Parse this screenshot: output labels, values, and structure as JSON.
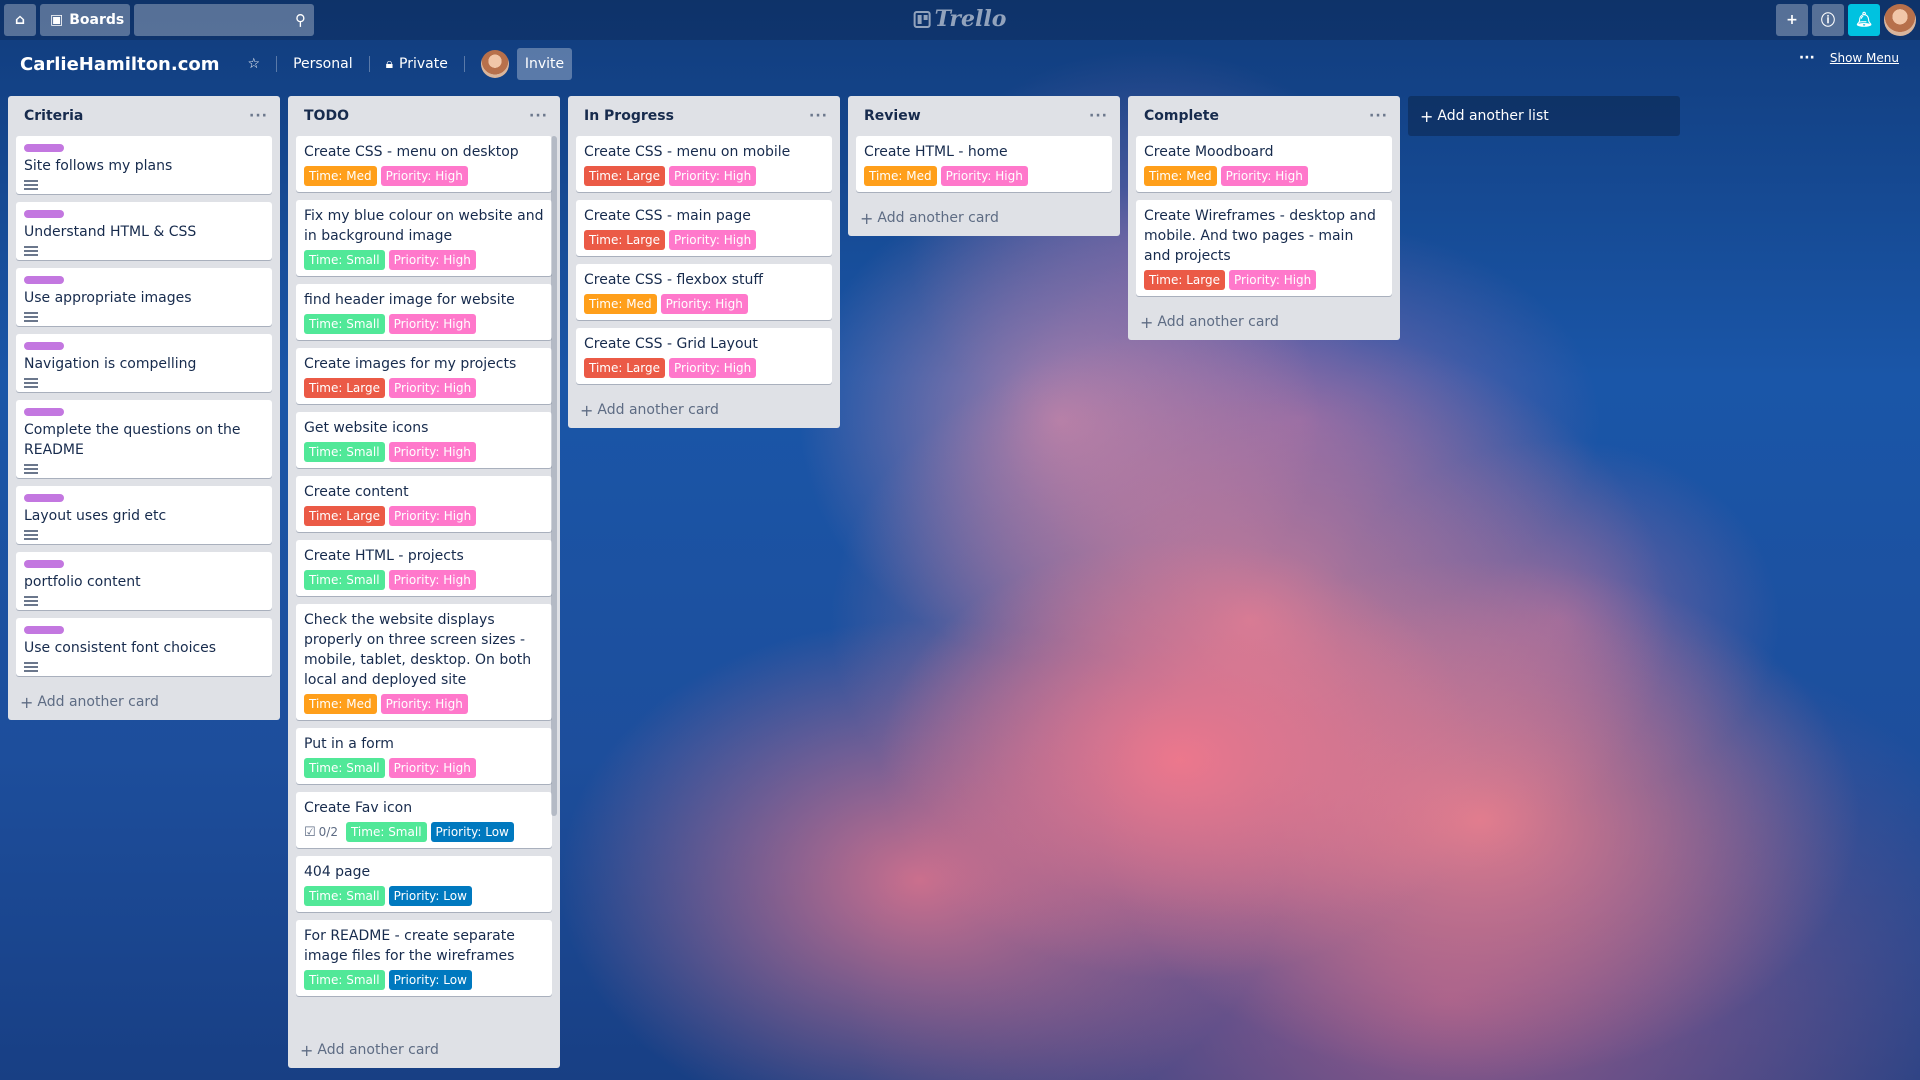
{
  "header": {
    "boards_label": "Boards",
    "search_value": "",
    "logo_text": "Trello"
  },
  "board": {
    "title": "CarlieHamilton.com",
    "team": "Personal",
    "visibility": "Private",
    "invite_label": "Invite",
    "show_menu_label": "Show Menu"
  },
  "colors": {
    "time_small": "#61bd4f",
    "time_small_text": "#51e898",
    "time_med": "#ff9f1a",
    "time_large": "#eb5a46",
    "priority_high": "#ff78cb",
    "priority_low": "#0079bf",
    "criteria_label": "#c377e0"
  },
  "lists": [
    {
      "title": "Criteria",
      "add_card": "Add another card",
      "cards": [
        {
          "title": "Site follows my plans"
        },
        {
          "title": "Understand HTML & CSS"
        },
        {
          "title": "Use appropriate images"
        },
        {
          "title": "Navigation is compelling"
        },
        {
          "title": "Complete the questions on the README"
        },
        {
          "title": "Layout uses grid etc"
        },
        {
          "title": "portfolio content"
        },
        {
          "title": "Use consistent font choices"
        }
      ]
    },
    {
      "title": "TODO",
      "add_card": "Add another card",
      "cards": [
        {
          "title": "Create CSS - menu on desktop",
          "time": "Time: Med",
          "priority": "Priority: High"
        },
        {
          "title": "Fix my blue colour on website and in background image",
          "time": "Time: Small",
          "priority": "Priority: High"
        },
        {
          "title": "find header image for website",
          "time": "Time: Small",
          "priority": "Priority: High"
        },
        {
          "title": "Create images for my projects",
          "time": "Time: Large",
          "priority": "Priority: High"
        },
        {
          "title": "Get website icons",
          "time": "Time: Small",
          "priority": "Priority: High"
        },
        {
          "title": "Create content",
          "time": "Time: Large",
          "priority": "Priority: High"
        },
        {
          "title": "Create HTML - projects",
          "time": "Time: Small",
          "priority": "Priority: High"
        },
        {
          "title": "Check the website displays properly on three screen sizes - mobile, tablet, desktop. On both local and deployed site",
          "time": "Time: Med",
          "priority": "Priority: High"
        },
        {
          "title": "Put in a form",
          "time": "Time: Small",
          "priority": "Priority: High"
        },
        {
          "title": "Create Fav icon",
          "checklist": "0/2",
          "time": "Time: Small",
          "priority": "Priority: Low"
        },
        {
          "title": "404 page",
          "time": "Time: Small",
          "priority": "Priority: Low"
        },
        {
          "title": "For README - create separate image files for the wireframes",
          "time": "Time: Small",
          "priority": "Priority: Low"
        }
      ]
    },
    {
      "title": "In Progress",
      "add_card": "Add another card",
      "cards": [
        {
          "title": "Create CSS - menu on mobile",
          "time": "Time: Large",
          "priority": "Priority: High"
        },
        {
          "title": "Create CSS - main page",
          "time": "Time: Large",
          "priority": "Priority: High"
        },
        {
          "title": "Create CSS - flexbox stuff",
          "time": "Time: Med",
          "priority": "Priority: High"
        },
        {
          "title": "Create CSS - Grid Layout",
          "time": "Time: Large",
          "priority": "Priority: High"
        }
      ]
    },
    {
      "title": "Review",
      "add_card": "Add another card",
      "cards": [
        {
          "title": "Create HTML - home",
          "time": "Time: Med",
          "priority": "Priority: High"
        }
      ]
    },
    {
      "title": "Complete",
      "add_card": "Add another card",
      "cards": [
        {
          "title": "Create Moodboard",
          "time": "Time: Med",
          "priority": "Priority: High"
        },
        {
          "title": "Create Wireframes - desktop and mobile. And two pages - main and projects",
          "time": "Time: Large",
          "priority": "Priority: High"
        }
      ]
    }
  ],
  "add_list_label": "Add another list"
}
